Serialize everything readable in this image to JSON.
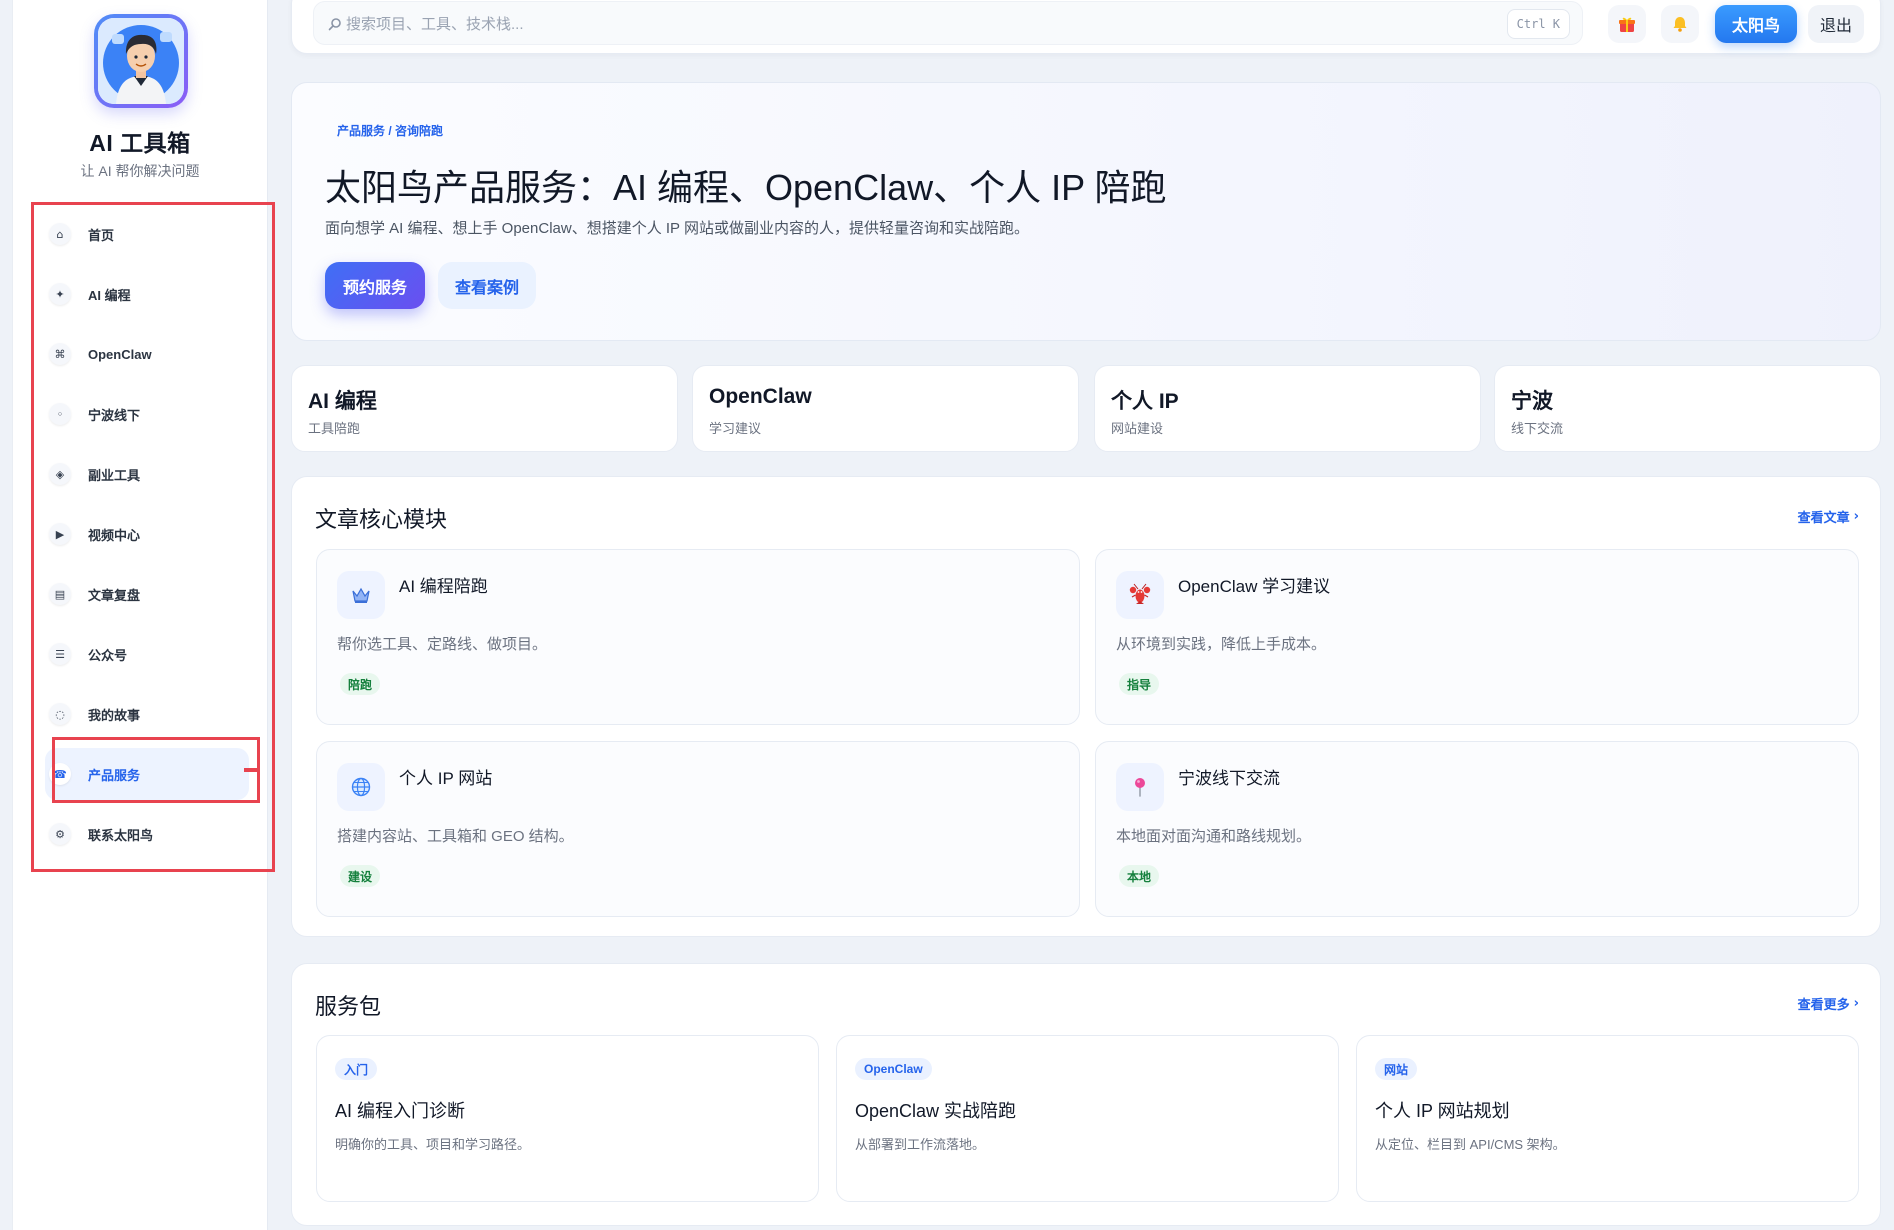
{
  "sidebar": {
    "brand": {
      "title": "AI 工具箱",
      "subtitle": "让 AI 帮你解决问题",
      "avatar_icon": "avatar-icon"
    },
    "items": [
      {
        "label": "首页",
        "icon": "home-icon",
        "active": false
      },
      {
        "label": "AI 编程",
        "icon": "sparkle-icon",
        "active": false
      },
      {
        "label": "OpenClaw",
        "icon": "command-icon",
        "active": false
      },
      {
        "label": "宁波线下",
        "icon": "dot-icon",
        "active": false
      },
      {
        "label": "副业工具",
        "icon": "diamond-icon",
        "active": false
      },
      {
        "label": "视频中心",
        "icon": "play-icon",
        "active": false
      },
      {
        "label": "文章复盘",
        "icon": "document-icon",
        "active": false
      },
      {
        "label": "公众号",
        "icon": "menu-icon",
        "active": false
      },
      {
        "label": "我的故事",
        "icon": "story-icon",
        "active": false
      },
      {
        "label": "产品服务",
        "icon": "service-icon",
        "active": true
      },
      {
        "label": "联系太阳鸟",
        "icon": "gear-icon",
        "active": false
      }
    ]
  },
  "topbar": {
    "search_placeholder": "搜索项目、工具、技术栈...",
    "search_icon": "search-icon",
    "shortcut": "Ctrl K",
    "gift_icon": "gift-icon",
    "bell_icon": "bell-icon",
    "user_button": "太阳鸟",
    "logout_button": "退出"
  },
  "hero": {
    "breadcrumb": "产品服务 / 咨询陪跑",
    "title": "太阳鸟产品服务：AI 编程、OpenClaw、个人 IP 陪跑",
    "description": "面向想学 AI 编程、想上手 OpenClaw、想搭建个人 IP 网站或做副业内容的人，提供轻量咨询和实战陪跑。",
    "primary_button": "预约服务",
    "secondary_button": "查看案例"
  },
  "stats": [
    {
      "title": "AI 编程",
      "subtitle": "工具陪跑"
    },
    {
      "title": "OpenClaw",
      "subtitle": "学习建议"
    },
    {
      "title": "个人 IP",
      "subtitle": "网站建设"
    },
    {
      "title": "宁波",
      "subtitle": "线下交流"
    }
  ],
  "articles": {
    "heading": "文章核心模块",
    "link": "查看文章",
    "cards": [
      {
        "title": "AI 编程陪跑",
        "description": "帮你选工具、定路线、做项目。",
        "tag": "陪跑",
        "icon": "crown-icon"
      },
      {
        "title": "OpenClaw 学习建议",
        "description": "从环境到实践，降低上手成本。",
        "tag": "指导",
        "icon": "lobster-icon"
      },
      {
        "title": "个人 IP 网站",
        "description": "搭建内容站、工具箱和 GEO 结构。",
        "tag": "建设",
        "icon": "globe-icon"
      },
      {
        "title": "宁波线下交流",
        "description": "本地面对面沟通和路线规划。",
        "tag": "本地",
        "icon": "pin-icon"
      }
    ]
  },
  "services": {
    "heading": "服务包",
    "link": "查看更多",
    "cards": [
      {
        "tag": "入门",
        "title": "AI 编程入门诊断",
        "description": "明确你的工具、项目和学习路径。"
      },
      {
        "tag": "OpenClaw",
        "title": "OpenClaw 实战陪跑",
        "description": "从部署到工作流落地。"
      },
      {
        "tag": "网站",
        "title": "个人 IP 网站规划",
        "description": "从定位、栏目到 API/CMS 架构。"
      }
    ]
  },
  "colors": {
    "accent": "#2563eb",
    "page_background": "#eef2f8",
    "annotation_red": "#e8434f",
    "tag_green": "#15803d",
    "primary_gradient": [
      "#3f6ff5",
      "#6a4ff0"
    ]
  }
}
